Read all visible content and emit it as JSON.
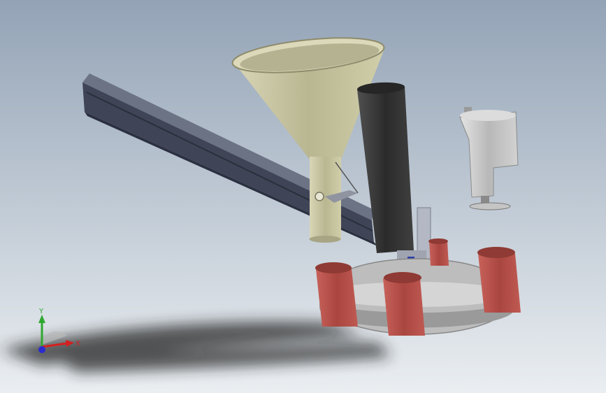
{
  "viewport": {
    "background_top": "#93a3b6",
    "background_bottom": "#eaeef1"
  },
  "triad": {
    "x_label": "X",
    "y_label": "Y",
    "x_color": "#d42020",
    "y_color": "#2fa82f",
    "z_color": "#2a2ad0"
  },
  "colors": {
    "funnel": "#c7c4a0",
    "funnel_dark": "#8e8b6c",
    "tube": "#3b3b3b",
    "rail": "#4f5566",
    "tank": "#b9524c",
    "plate": "#bdbdbd",
    "actuator": "#c9c9c9",
    "shadow": "#222222"
  }
}
